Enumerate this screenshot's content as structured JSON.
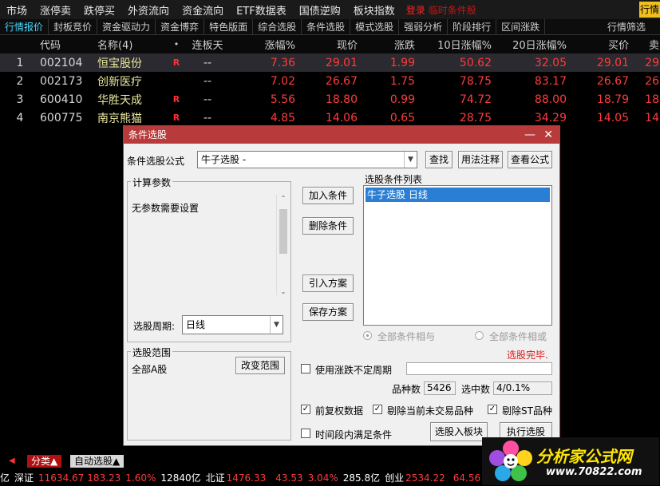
{
  "menu": {
    "items": [
      "市场",
      "涨停卖",
      "跌停买",
      "外资流向",
      "资金流向",
      "ETF数据表",
      "国债逆购",
      "板块指数"
    ],
    "login": "登录",
    "hot": "临时条件股",
    "right": "行情"
  },
  "tabs": {
    "items": [
      "行情报价",
      "封板竞价",
      "资金驱动力",
      "资金博弈",
      "特色版面",
      "综合选股",
      "条件选股",
      "模式选股",
      "强弱分析",
      "阶段排行",
      "区间涨跌"
    ],
    "right": "行情筛选"
  },
  "table": {
    "headers": {
      "code": "代码",
      "name": "名称(4)",
      "dot": "•",
      "lb": "连板天",
      "zf": "涨幅%",
      "xj": "现价",
      "zd": "涨跌",
      "d10": "10日涨幅%",
      "d20": "20日涨幅%",
      "mj": "买价",
      "x": "卖"
    },
    "rows": [
      {
        "no": "1",
        "code": "002104",
        "name": "恒宝股份",
        "r": "R",
        "lb": "--",
        "zf": "7.36",
        "xj": "29.01",
        "zd": "1.99",
        "d10": "50.62",
        "d20": "32.05",
        "mj": "29.01",
        "x": "29"
      },
      {
        "no": "2",
        "code": "002173",
        "name": "创新医疗",
        "r": "",
        "lb": "--",
        "zf": "7.02",
        "xj": "26.67",
        "zd": "1.75",
        "d10": "78.75",
        "d20": "83.17",
        "mj": "26.67",
        "x": "26"
      },
      {
        "no": "3",
        "code": "600410",
        "name": "华胜天成",
        "r": "R",
        "lb": "--",
        "zf": "5.56",
        "xj": "18.80",
        "zd": "0.99",
        "d10": "74.72",
        "d20": "88.00",
        "mj": "18.79",
        "x": "18"
      },
      {
        "no": "4",
        "code": "600775",
        "name": "南京熊猫",
        "r": "R",
        "lb": "--",
        "zf": "4.85",
        "xj": "14.06",
        "zd": "0.65",
        "d10": "28.75",
        "d20": "34.29",
        "mj": "14.05",
        "x": "14"
      }
    ]
  },
  "dialog": {
    "title": "条件选股",
    "formula_label": "条件选股公式",
    "formula_value": "牛子选股  -",
    "btn_find": "查找",
    "btn_usage": "用法注释",
    "btn_view": "查看公式",
    "params_title": "计算参数",
    "params_text": "无参数需要设置",
    "btn_add": "加入条件",
    "btn_del": "删除条件",
    "btn_import": "引入方案",
    "btn_save": "保存方案",
    "list_title": "选股条件列表",
    "list_item": "牛子选股  日线",
    "period_label": "选股周期:",
    "period_value": "日线",
    "radio_and": "全部条件相与",
    "radio_or": "全部条件相或",
    "done": "选股完毕.",
    "range_title": "选股范围",
    "range_value": "全部A股",
    "btn_range": "改变范围",
    "chk_uncertain": "使用涨跌不定周期",
    "count_label": "品种数",
    "count_value": "5426",
    "hit_label": "选中数",
    "hit_value": "4/0.1%",
    "chk_fq": "前复权数据",
    "chk_untraded": "剔除当前未交易品种",
    "chk_st": "剔除ST品种",
    "chk_interval": "时间段内满足条件",
    "btn_toblock": "选股入板块",
    "btn_run": "执行选股"
  },
  "bottom": {
    "tab_fenlei": "分类▲",
    "tab_auto": "自动选股▲"
  },
  "status": {
    "s0": "亿",
    "s1": "深证",
    "s2": "11634.67",
    "s3": "183.23",
    "s4": "1.60%",
    "s5": "12840亿",
    "s6": "北证",
    "s7": "1476.33",
    "s8": "43.53",
    "s9": "3.04%",
    "s10": "285.8亿",
    "s11": "创业",
    "s12": "2534.22",
    "s13": "64.56"
  },
  "logo": {
    "main": "分析家公式网",
    "url": "www.70822.com"
  }
}
